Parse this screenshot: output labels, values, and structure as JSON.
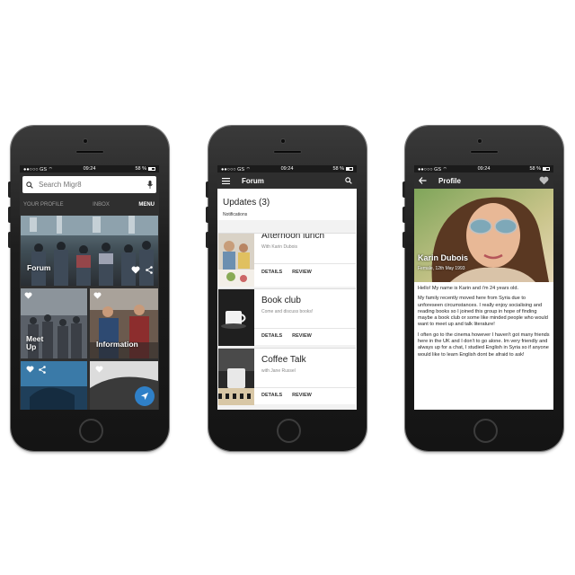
{
  "status_bar": {
    "carrier": "●●○○○ GS ⌔",
    "time": "09:24",
    "battery": "58 %"
  },
  "screen1": {
    "search": {
      "placeholder": "Search Migr8",
      "icon": "search-icon",
      "mic_icon": "microphone-icon"
    },
    "tabs": [
      "YOUR PROFILE",
      "INBOX",
      "MENU"
    ],
    "active_tab": "MENU",
    "tiles": {
      "forum": "Forum",
      "meet_up": "Meet\nUp",
      "information": "Information"
    },
    "fab_icon": "navigation-arrow-icon"
  },
  "screen2": {
    "title": "Forum",
    "updates_title": "Updates (3)",
    "updates_sub": "Notifications",
    "cards": [
      {
        "title": "Afternoon lunch",
        "subtitle": "With Karin Dubois",
        "details": "DETAILS",
        "review": "REVIEW"
      },
      {
        "title": "Book club",
        "subtitle": "Come and discuss books!",
        "details": "DETAILS",
        "review": "REVIEW"
      },
      {
        "title": "Coffee Talk",
        "subtitle": "with Jane Russel",
        "details": "DETAILS",
        "review": "REVIEW"
      }
    ]
  },
  "screen3": {
    "title": "Profile",
    "name": "Karin Dubois",
    "meta": "Female, 12th May 1993",
    "paragraphs": [
      "Hello! My name is Karin and i'm 24 years old.",
      "My family recently moved here from Syria due to unforeseen circumstances. I really enjoy socialising and reading books so I joined this group in hope of finding maybe a book club or some like minded people who would want to meet up and talk literature!",
      "I often go to the cinema however I haven't got many friends here in the UK and I don't to go alone. Im very friendly and always up for a chat, I studied English in Syria so if anyone would like to learn English dont be afraid to ask!"
    ]
  }
}
